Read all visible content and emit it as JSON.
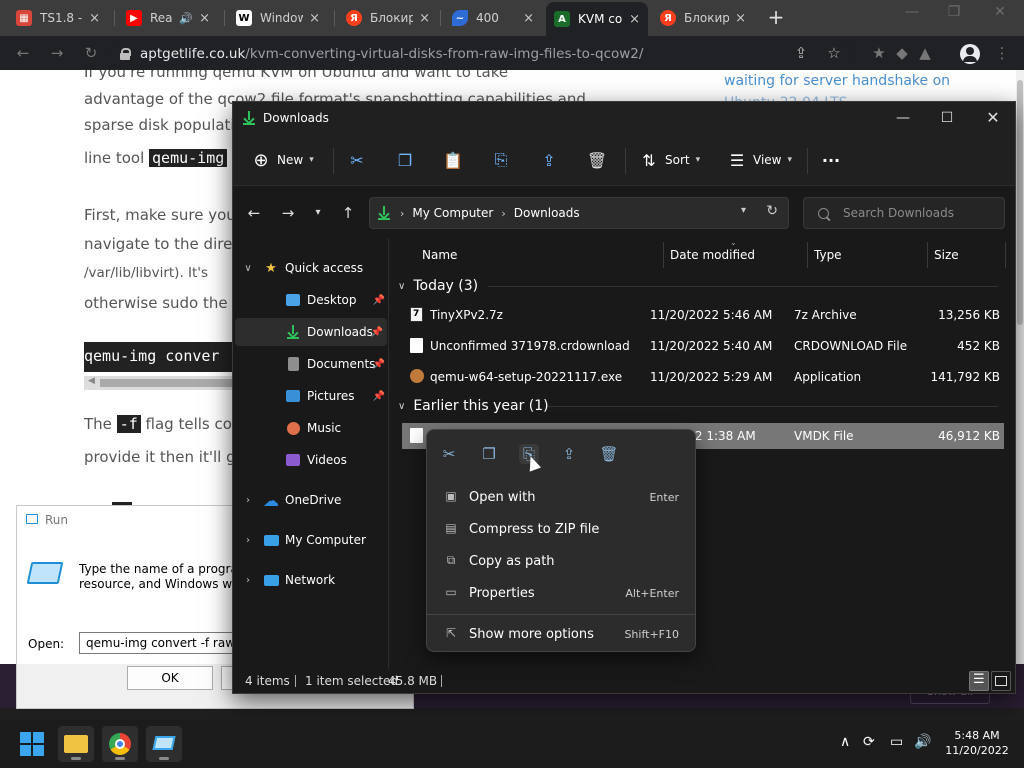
{
  "browser": {
    "tabs": [
      {
        "title": "TS1.8 - ",
        "favicon": "ts-icon",
        "color": "#d9473b"
      },
      {
        "title": "Rea",
        "favicon": "youtube-icon",
        "color": "#ff0000"
      },
      {
        "title": "Window",
        "favicon": "wiki-icon",
        "color": "#ffffff"
      },
      {
        "title": "Блокир",
        "favicon": "yandex-icon",
        "color": "#fc3f1d"
      },
      {
        "title": "400",
        "favicon": "feather-icon",
        "color": "#2d6bd6"
      },
      {
        "title": "KVM co",
        "favicon": "aptgetlife-icon",
        "color": "#1b6b2a"
      },
      {
        "title": "Блокир",
        "favicon": "yandex-icon",
        "color": "#fc3f1d"
      }
    ],
    "url_host": "aptgetlife.co.uk",
    "url_path": "/kvm-converting-virtual-disks-from-raw-img-files-to-qcow2/"
  },
  "webpage": {
    "lines": [
      "If you're running qemu KVM on Ubuntu and want to take",
      "advantage of the qcow2 file format's snapshotting capabilities and",
      "sparse disk populati",
      "line tool",
      "qemu-img",
      "First, make sure you",
      "navigate to the dire",
      "/var/lib/libvirt). It's",
      "otherwise sudo the",
      "qemu-img conver",
      "The",
      "-f",
      "flag tells co",
      "provide it then it'll g"
    ],
    "side_line1": "waiting for server handshake on",
    "side_line2": "Ubuntu 22.04 LTS",
    "bottom_right": "Show all"
  },
  "explorer": {
    "title": "Downloads",
    "toolbar": {
      "new": "New",
      "sort": "Sort",
      "view": "View"
    },
    "breadcrumb": [
      "My Computer",
      "Downloads"
    ],
    "search_placeholder": "Search Downloads",
    "nav": {
      "quick_access": "Quick access",
      "desktop": "Desktop",
      "downloads": "Downloads",
      "documents": "Documents",
      "pictures": "Pictures",
      "music": "Music",
      "videos": "Videos",
      "onedrive": "OneDrive",
      "my_computer": "My Computer",
      "network": "Network"
    },
    "columns": {
      "name": "Name",
      "date": "Date modified",
      "type": "Type",
      "size": "Size"
    },
    "groups": {
      "today": "Today (3)",
      "earlier": "Earlier this year (1)"
    },
    "files": [
      {
        "name": "TinyXPv2.7z",
        "date": "11/20/2022 5:46 AM",
        "type": "7z Archive",
        "size": "13,256 KB"
      },
      {
        "name": "Unconfirmed 371978.crdownload",
        "date": "11/20/2022 5:40 AM",
        "type": "CRDOWNLOAD File",
        "size": "452 KB"
      },
      {
        "name": "qemu-w64-setup-20221117.exe",
        "date": "11/20/2022 5:29 AM",
        "type": "Application",
        "size": "141,792 KB"
      },
      {
        "name": "",
        "date": "2022 1:38 AM",
        "type": "VMDK File",
        "size": "46,912 KB"
      }
    ],
    "status": {
      "items": "4 items",
      "selected": "1 item selected",
      "size": "45.8 MB"
    }
  },
  "context_menu": {
    "items": [
      {
        "label": "Open with",
        "shortcut": "Enter"
      },
      {
        "label": "Compress to ZIP file",
        "shortcut": ""
      },
      {
        "label": "Copy as path",
        "shortcut": ""
      },
      {
        "label": "Properties",
        "shortcut": "Alt+Enter"
      },
      {
        "label": "Show more options",
        "shortcut": "Shift+F10"
      }
    ]
  },
  "run_dialog": {
    "title": "Run",
    "line1": "Type the name of a program,",
    "line2": "resource, and Windows will o",
    "open_label": "Open:",
    "input_value": "qemu-img convert -f raw -O",
    "ok": "OK"
  },
  "taskbar": {
    "time": "5:48 AM",
    "date": "11/20/2022"
  }
}
